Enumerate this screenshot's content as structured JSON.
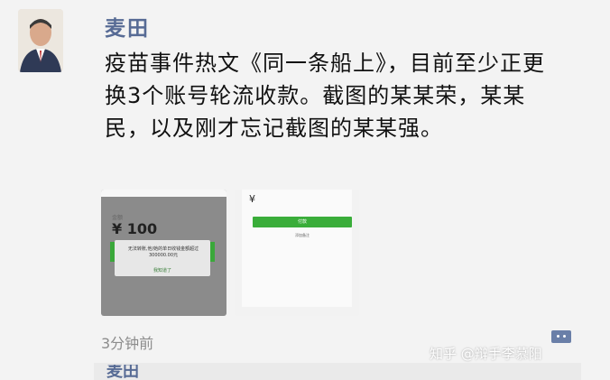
{
  "post": {
    "author": "麦田",
    "text": "疫苗事件热文《同一条船上》，目前至少正更换3个账号轮流收款。截图的某某荣，某某民，以及刚才忘记截图的某某强。",
    "timestamp": "3分钟前"
  },
  "thumbnails": [
    {
      "currency_amount": "¥ 100",
      "label": "金额",
      "dialog_message": "无法转账,他/她的单日收钱金额超过300000.00元",
      "dialog_button": "我知道了"
    },
    {
      "currency": "¥",
      "button": "付款",
      "link": "添加备注"
    }
  ],
  "watermark": "知乎 @辩手李慕阳",
  "next_author_partial": "麦田",
  "colors": {
    "author_blue": "#576b95",
    "pay_green": "#3aad3a"
  },
  "icons": {
    "comment": "comment-icon"
  }
}
